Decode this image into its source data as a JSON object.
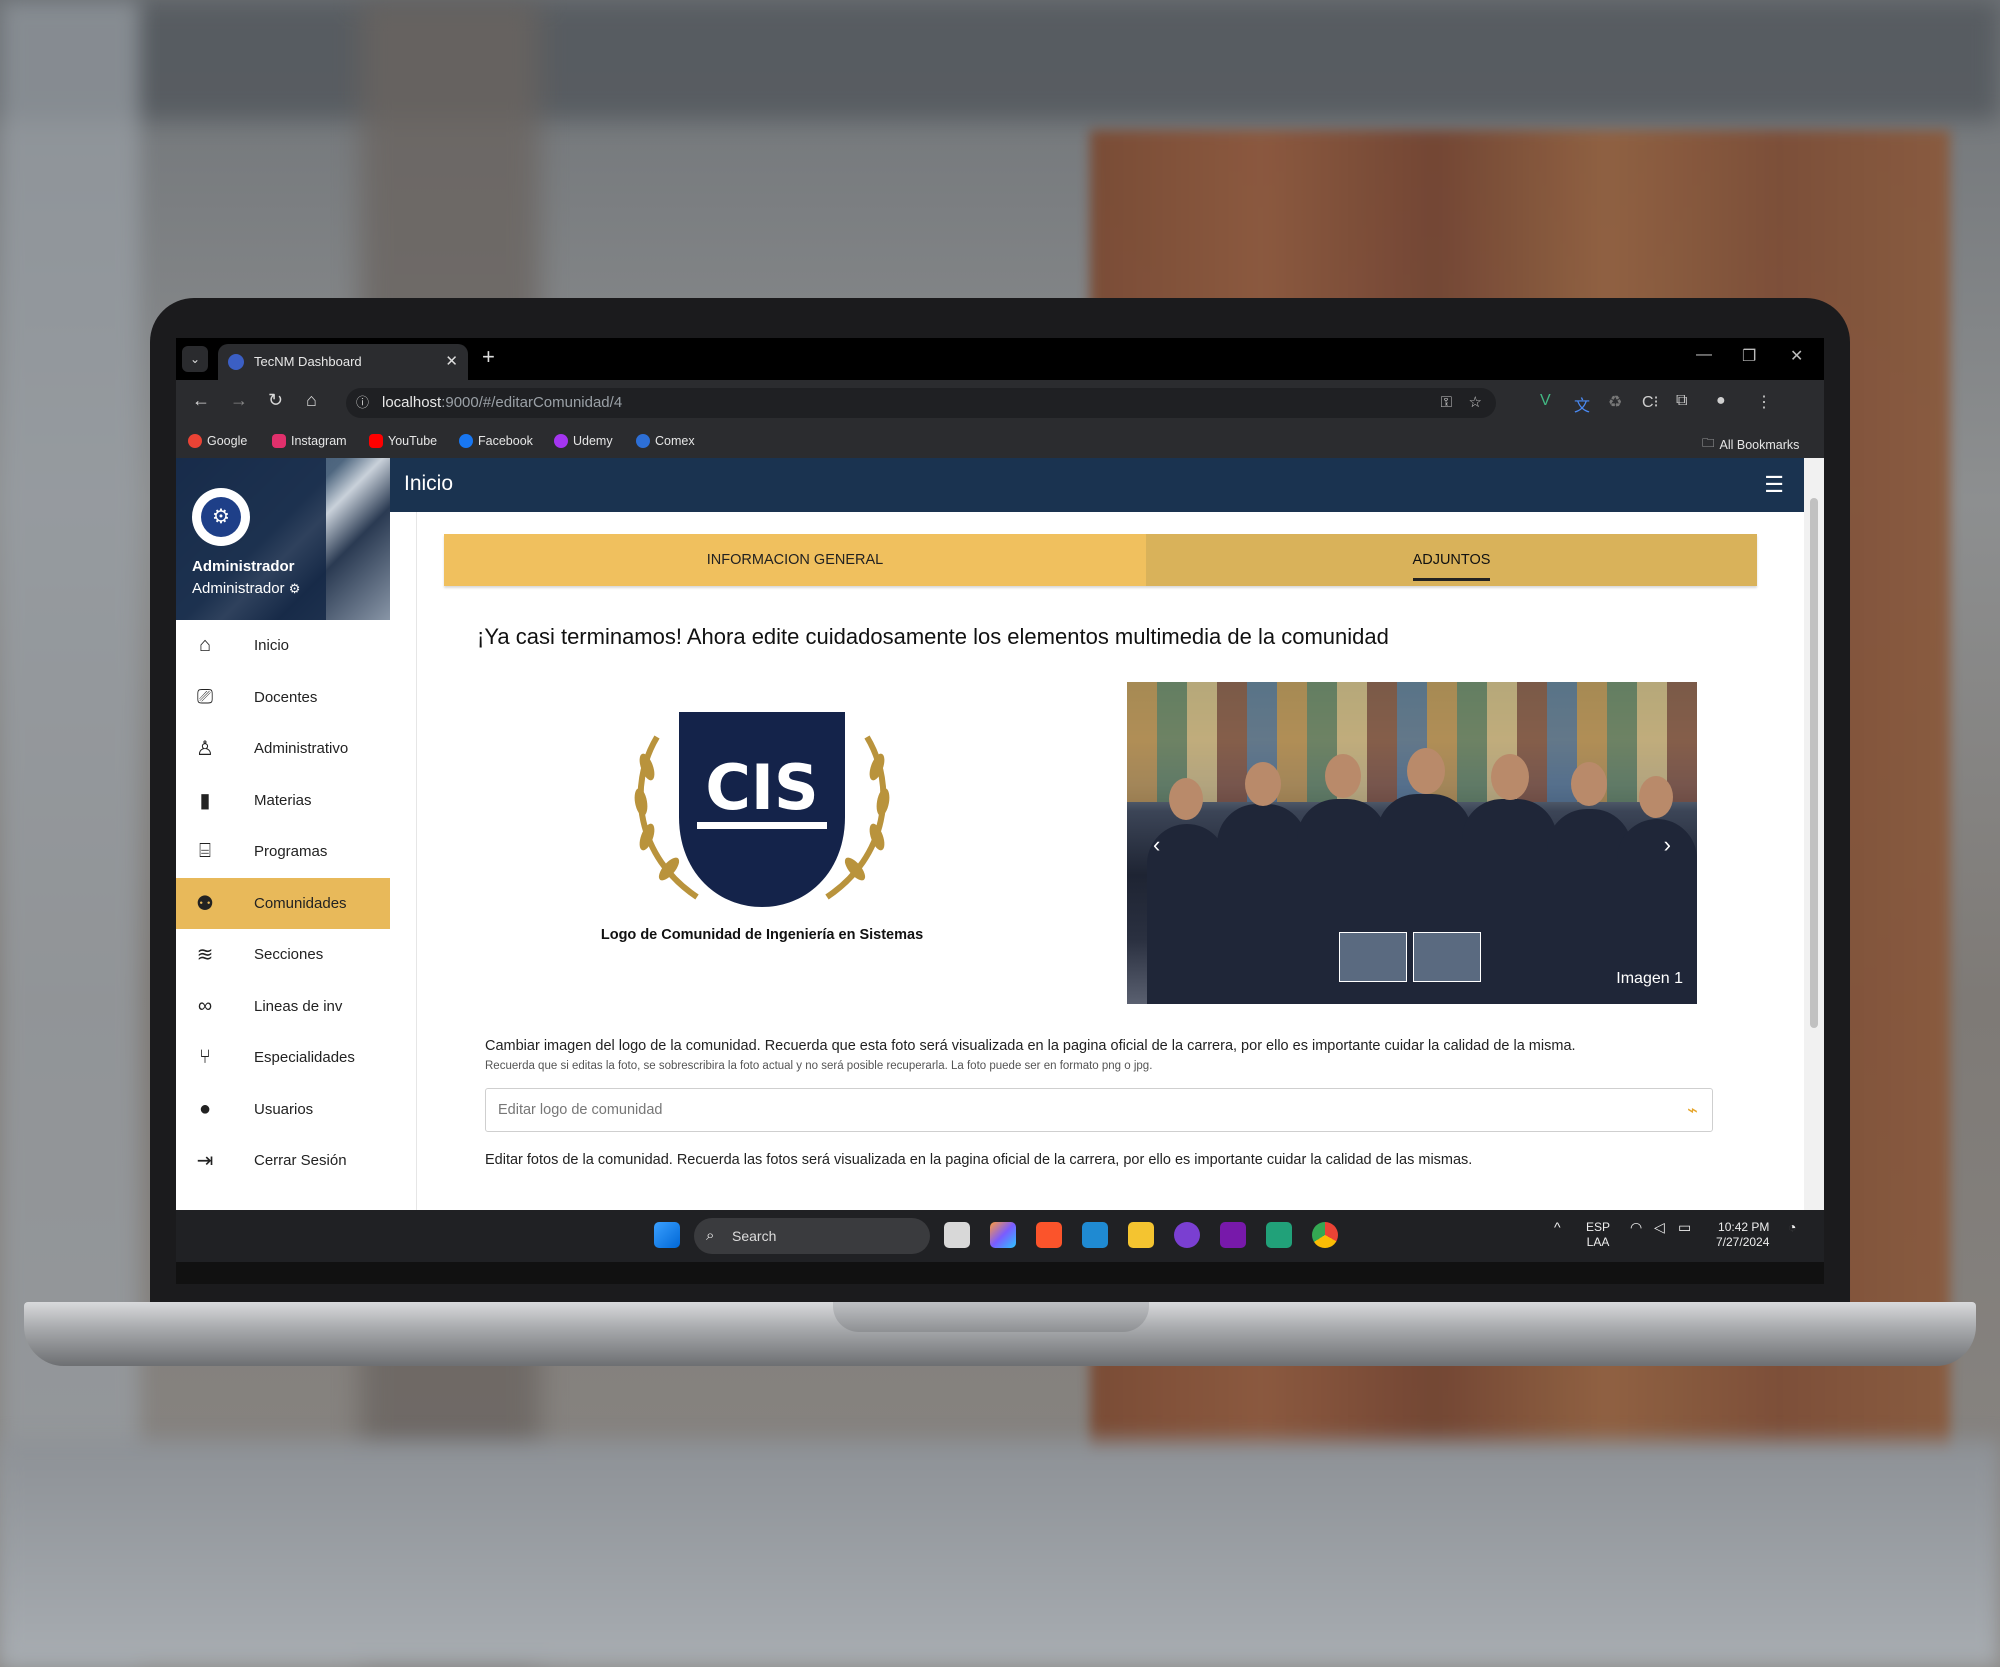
{
  "browser": {
    "tab_title": "TecNM Dashboard",
    "tab_close": "✕",
    "new_tab": "+",
    "url_host": "localhost",
    "url_path": ":9000/#/editarComunidad/4",
    "bookmarks": [
      "Google",
      "Instagram",
      "YouTube",
      "Facebook",
      "Udemy",
      "Comex"
    ],
    "all_bookmarks": "All Bookmarks",
    "bookmark_colors": [
      "#ea4335",
      "#e1306c",
      "#ff0000",
      "#1877f2",
      "#a435f0",
      "#2d6fd6"
    ]
  },
  "sidebar": {
    "user_name": "Administrador",
    "user_role": "Administrador",
    "items": [
      {
        "label": "Inicio",
        "icon": "home-icon"
      },
      {
        "label": "Docentes",
        "icon": "teacher-icon"
      },
      {
        "label": "Administrativo",
        "icon": "person-icon"
      },
      {
        "label": "Materias",
        "icon": "book-icon"
      },
      {
        "label": "Programas",
        "icon": "institution-icon"
      },
      {
        "label": "Comunidades",
        "icon": "group-icon",
        "active": true
      },
      {
        "label": "Secciones",
        "icon": "layers-icon"
      },
      {
        "label": "Lineas de inv",
        "icon": "glasses-icon"
      },
      {
        "label": "Especialidades",
        "icon": "branch-icon"
      },
      {
        "label": "Usuarios",
        "icon": "user-icon"
      },
      {
        "label": "Cerrar Sesión",
        "icon": "logout-icon"
      }
    ]
  },
  "header": {
    "title": "Inicio"
  },
  "tabs": {
    "general": "INFORMACION GENERAL",
    "adjuntos": "ADJUNTOS"
  },
  "main": {
    "headline": "¡Ya casi terminamos! Ahora edite cuidadosamente los elementos multimedia de la comunidad",
    "logo_text": "CIS",
    "logo_caption": "Logo de Comunidad de Ingeniería en Sistemas",
    "carousel_caption": "Imagen 1",
    "logo_desc": "Cambiar imagen del logo de la comunidad. Recuerda que esta foto será visualizada en la pagina oficial de la carrera, por ello es importante cuidar la calidad de la misma.",
    "logo_hint": "Recuerda que si editas la foto, se sobrescribira la foto actual y no será posible recuperarla. La foto puede ser en formato png o jpg.",
    "logo_input_placeholder": "Editar logo de comunidad",
    "photos_desc": "Editar fotos de la comunidad. Recuerda las fotos será visualizada en la pagina oficial de la carrera, por ello es importante cuidar la calidad de las mismas."
  },
  "taskbar": {
    "search": "Search",
    "lang": "ESP",
    "layout": "LAA",
    "time": "10:42 PM",
    "date": "7/27/2024"
  },
  "colors": {
    "accent": "#f0c05e",
    "header": "#1a3350",
    "active_item": "#e8b95a"
  }
}
